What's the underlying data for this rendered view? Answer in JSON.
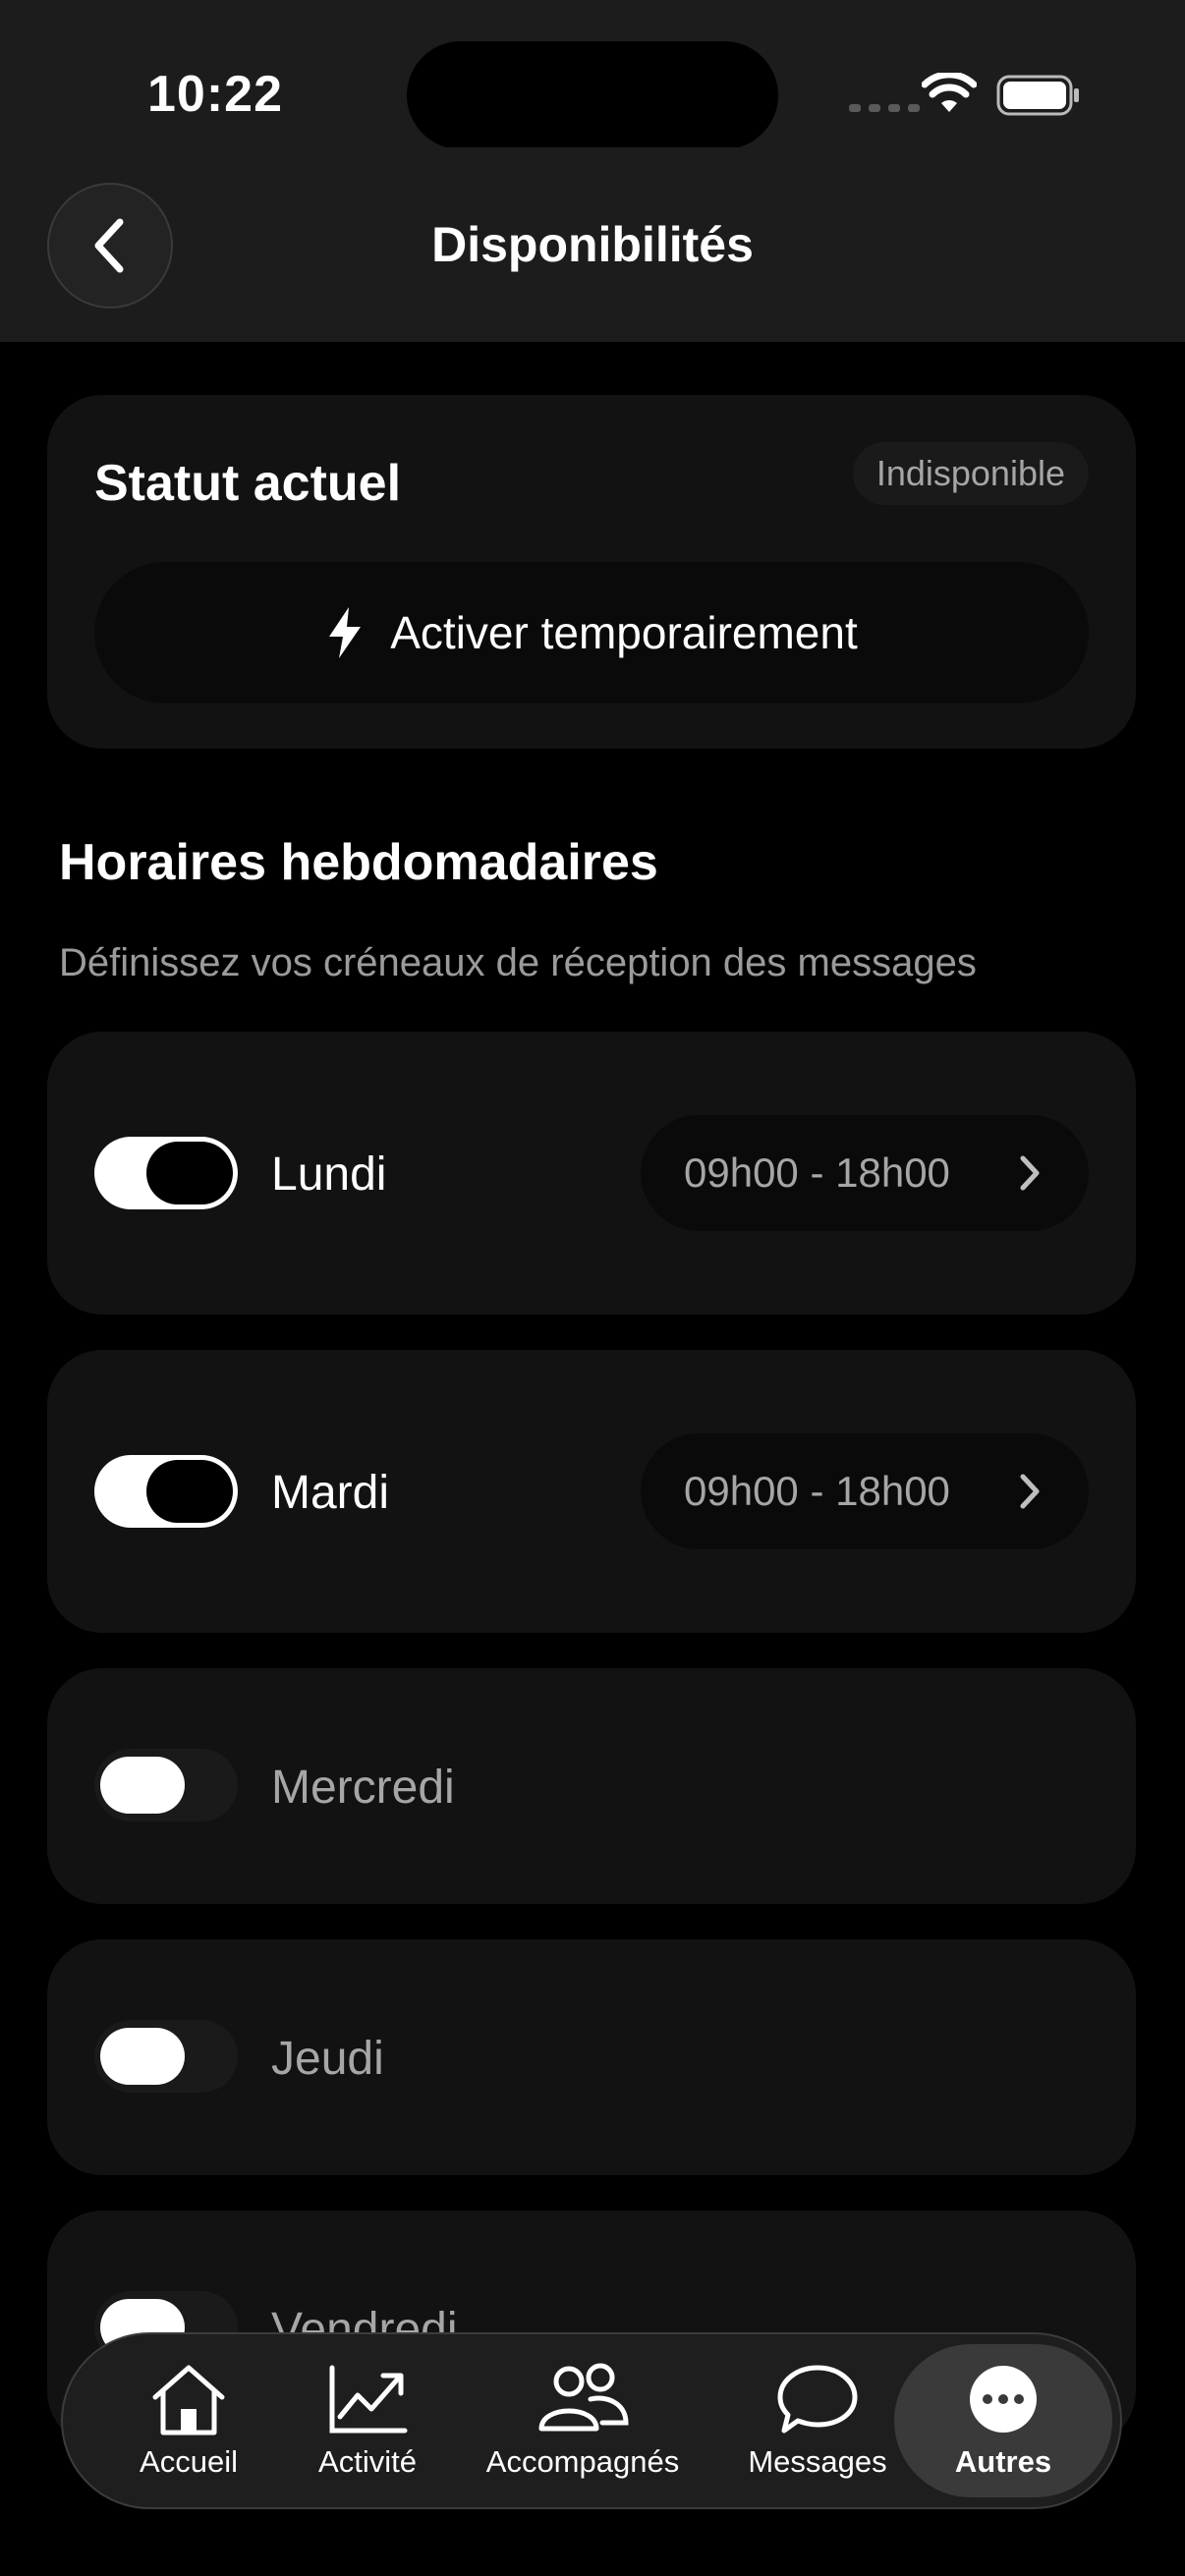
{
  "status_bar": {
    "time": "10:22"
  },
  "header": {
    "title": "Disponibilités"
  },
  "current_status": {
    "title": "Statut actuel",
    "badge": "Indisponible",
    "activate_label": "Activer temporairement"
  },
  "weekly": {
    "title": "Horaires hebdomadaires",
    "subtitle": "Définissez vos créneaux de réception des messages",
    "days": [
      {
        "label": "Lundi",
        "enabled": true,
        "hours": "09h00 - 18h00"
      },
      {
        "label": "Mardi",
        "enabled": true,
        "hours": "09h00 - 18h00"
      },
      {
        "label": "Mercredi",
        "enabled": false
      },
      {
        "label": "Jeudi",
        "enabled": false
      },
      {
        "label": "Vendredi",
        "enabled": false
      }
    ]
  },
  "tabs": [
    {
      "label": "Accueil",
      "icon": "home-icon",
      "active": false
    },
    {
      "label": "Activité",
      "icon": "chart-trend-icon",
      "active": false
    },
    {
      "label": "Accompagnés",
      "icon": "users-icon",
      "active": false
    },
    {
      "label": "Messages",
      "icon": "chat-bubble-icon",
      "active": false
    },
    {
      "label": "Autres",
      "icon": "more-dots-icon",
      "active": true
    }
  ]
}
